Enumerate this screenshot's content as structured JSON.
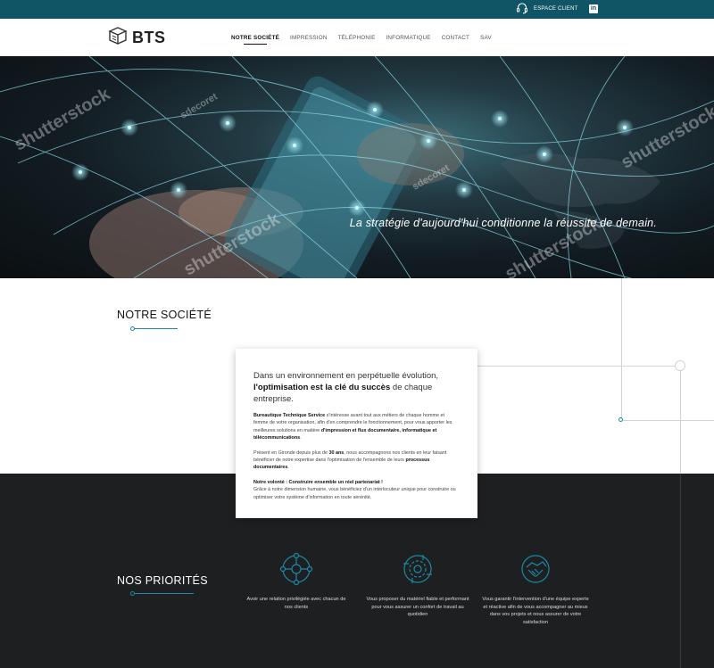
{
  "topbar": {
    "client_label": "ESPACE CLIENT",
    "linkedin_label": "in"
  },
  "header": {
    "logo_text": "BTS",
    "nav": [
      "NOTRE SOCIÉTÉ",
      "IMPRESSION",
      "TÉLÉPHONIE",
      "INFORMATIQUE",
      "CONTACT",
      "SAV"
    ]
  },
  "hero": {
    "tagline": "La stratégie d'aujourd'hui conditionne la réussite de demain.",
    "watermark": "shutterstock",
    "watermark_author": "sdecoret"
  },
  "societe": {
    "title": "NOTRE SOCIÉTÉ",
    "lead_1": "Dans un environnement en perpétuelle évolution,",
    "lead_bold": "l'optimisation est la clé du succès",
    "lead_2": " de chaque entreprise.",
    "p1_bold": "Bureautique Technique Service",
    "p1_text": " s'intéresse avant tout aux métiers de chaque homme et femme de votre organisation, afin d'en comprendre le fonctionnement, pour vous apporter les meilleures solutions en matière ",
    "p1_bold2": "d'impression et flux documentaire, informatique et télécommunications",
    "p1_end": ".",
    "p2_text": "Présent en Gironde depuis plus de ",
    "p2_bold": "30 ans",
    "p2_text2": ", nous accompagnons nos clients en leur faisant bénéficier de notre expertise dans l'optimisation de l'ensemble de leurs ",
    "p2_bold2": "processus documentaires",
    "p2_end": ".",
    "p3_bold": "Notre volonté : Construire ensemble un réel partenariat !",
    "p3_text": "Grâce à notre dimension humaine, vous bénéficiez d'un interlocuteur unique pour construire ou optimiser votre système d'information en toute sérénité."
  },
  "priorities": {
    "title": "NOS PRIORITÉS",
    "items": [
      {
        "icon": "network-icon",
        "text": "Avoir une relation privilégiée avec chacun de nos clients"
      },
      {
        "icon": "gear-circuit-icon",
        "text": "Vous proposer du matériel fiable et performant pour vous assurer un confort de travail au quotidien"
      },
      {
        "icon": "handshake-icon",
        "text": "Vous garantir l'intervention d'une équipe experte et réactive afin de vous accompagner au mieux dans vos projets et nous assurer de votre satisfaction"
      }
    ]
  },
  "colors": {
    "topbar": "#0f5566",
    "accent": "#1c8aa6",
    "dark": "#1e1f21"
  }
}
